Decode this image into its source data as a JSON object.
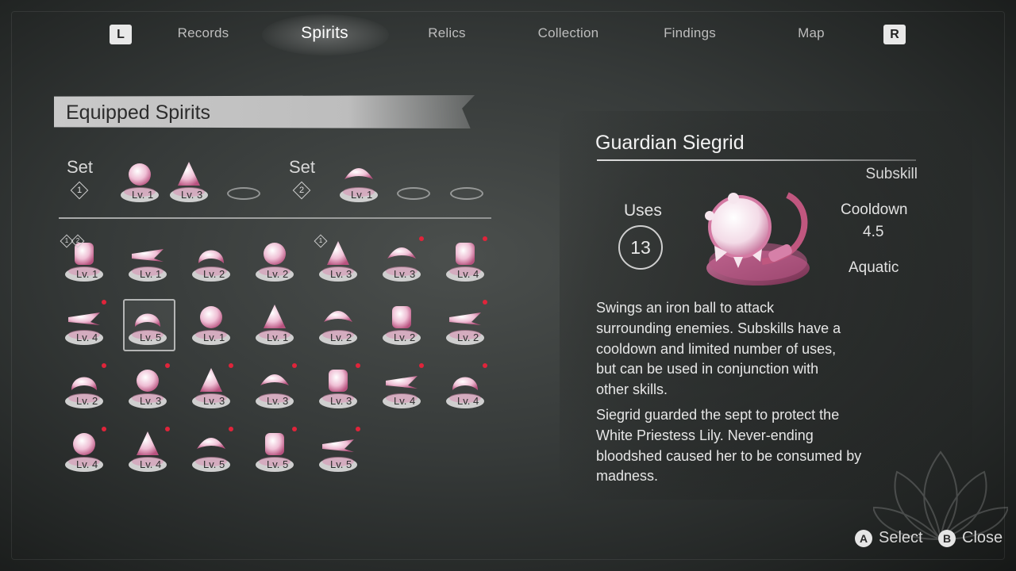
{
  "nav": {
    "left_bumper": "L",
    "right_bumper": "R",
    "tabs": [
      {
        "label": "Records"
      },
      {
        "label": "Spirits"
      },
      {
        "label": "Relics"
      },
      {
        "label": "Collection"
      },
      {
        "label": "Findings"
      },
      {
        "label": "Map"
      }
    ],
    "active_tab": "Spirits"
  },
  "equipped": {
    "title": "Equipped Spirits",
    "sets": [
      {
        "label": "Set",
        "number": "1",
        "slots": [
          {
            "icon": "pickaxe-icon",
            "level": "Lv. 1"
          },
          {
            "icon": "crystal-icon",
            "level": "Lv. 3"
          },
          {
            "empty": true
          }
        ]
      },
      {
        "label": "Set",
        "number": "2",
        "slots": [
          {
            "icon": "pickaxe-icon",
            "level": "Lv. 1"
          },
          {
            "empty": true
          },
          {
            "empty": true
          }
        ]
      }
    ]
  },
  "spirits": [
    {
      "icon": "crossbow-icon",
      "level": "Lv. 1",
      "sets": [
        "1",
        "2"
      ]
    },
    {
      "icon": "knight-icon",
      "level": "Lv. 1"
    },
    {
      "icon": "armored-knight-icon",
      "level": "Lv. 2"
    },
    {
      "icon": "arrow-thrust-icon",
      "level": "Lv. 2"
    },
    {
      "icon": "crystal-icon",
      "level": "Lv. 3",
      "sets": [
        "1"
      ]
    },
    {
      "icon": "cloud-icon",
      "level": "Lv. 3",
      "new": true
    },
    {
      "icon": "spear-icon",
      "level": "Lv. 4",
      "new": true
    },
    {
      "icon": "wave-icon",
      "level": "Lv. 4",
      "new": true
    },
    {
      "icon": "iron-ball-icon",
      "level": "Lv. 5",
      "selected": true
    },
    {
      "icon": "claw-icon",
      "level": "Lv. 1"
    },
    {
      "icon": "skull-shield-icon",
      "level": "Lv. 1"
    },
    {
      "icon": "bird-icon",
      "level": "Lv. 2"
    },
    {
      "icon": "wolf-icon",
      "level": "Lv. 2"
    },
    {
      "icon": "bow-icon",
      "level": "Lv. 2",
      "new": true
    },
    {
      "icon": "burst-icon",
      "level": "Lv. 2",
      "new": true
    },
    {
      "icon": "smoke-icon",
      "level": "Lv. 3",
      "new": true
    },
    {
      "icon": "tornado-icon",
      "level": "Lv. 3",
      "new": true
    },
    {
      "icon": "blade-icon",
      "level": "Lv. 3",
      "new": true
    },
    {
      "icon": "flask-icon",
      "level": "Lv. 3",
      "new": true
    },
    {
      "icon": "scythe-icon",
      "level": "Lv. 4",
      "new": true
    },
    {
      "icon": "beast-icon",
      "level": "Lv. 4",
      "new": true
    },
    {
      "icon": "fire-swirl-icon",
      "level": "Lv. 4",
      "new": true
    },
    {
      "icon": "flames-icon",
      "level": "Lv. 4",
      "new": true
    },
    {
      "icon": "vortex-icon",
      "level": "Lv. 5",
      "new": true
    },
    {
      "icon": "pillar-icon",
      "level": "Lv. 5",
      "new": true
    },
    {
      "icon": "flower-icon",
      "level": "Lv. 5",
      "new": true
    }
  ],
  "detail": {
    "name": "Guardian Siegrid",
    "type": "Subskill",
    "uses_label": "Uses",
    "uses": "13",
    "cooldown_label": "Cooldown",
    "cooldown": "4.5",
    "attribute": "Aquatic",
    "description_lines": [
      "Swings an iron ball to attack",
      "surrounding enemies. Subskills have a",
      "cooldown and limited number of uses,",
      "but can be used in conjunction with",
      "other skills."
    ],
    "lore_lines": [
      "Siegrid guarded the sept to protect the",
      "White Priestess Lily. Never-ending",
      "bloodshed caused her to be consumed by",
      "madness."
    ]
  },
  "buttons": {
    "select": {
      "key": "A",
      "label": "Select"
    },
    "close": {
      "key": "B",
      "label": "Close"
    }
  },
  "colors": {
    "accent": "#e8a6c6",
    "icon_dark": "#c0577f",
    "new_dot": "#e0243a"
  }
}
